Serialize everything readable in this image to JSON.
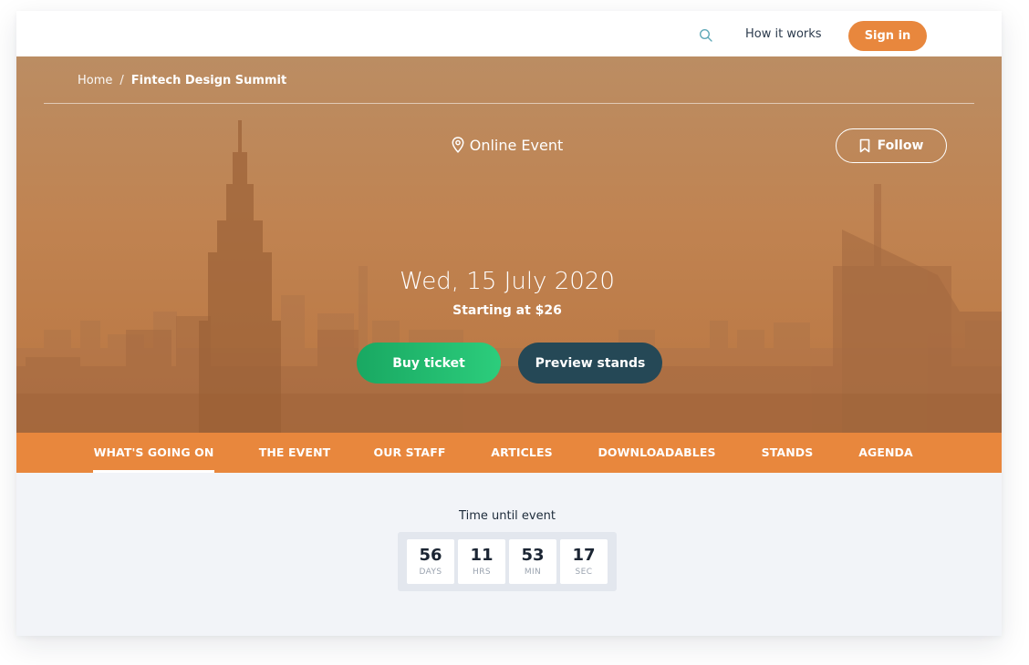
{
  "topbar": {
    "search_icon": "search-icon",
    "how_it_works": "How it works",
    "sign_in": "Sign in"
  },
  "breadcrumb": {
    "home": "Home",
    "separator": "/",
    "current": "Fintech Design Summit"
  },
  "hero": {
    "location_icon": "map-pin-icon",
    "location": "Online Event",
    "follow_icon": "bookmark-icon",
    "follow": "Follow",
    "date": "Wed, 15 July 2020",
    "price": "Starting at $26",
    "buy_ticket": "Buy ticket",
    "preview_stands": "Preview stands"
  },
  "nav": {
    "tabs": [
      {
        "label": "WHAT'S GOING ON",
        "active": true
      },
      {
        "label": "THE EVENT",
        "active": false
      },
      {
        "label": "OUR STAFF",
        "active": false
      },
      {
        "label": "ARTICLES",
        "active": false
      },
      {
        "label": "DOWNLOADABLES",
        "active": false
      },
      {
        "label": "STANDS",
        "active": false
      },
      {
        "label": "AGENDA",
        "active": false
      }
    ]
  },
  "countdown": {
    "label": "Time until event",
    "units": [
      {
        "value": "56",
        "unit": "DAYS"
      },
      {
        "value": "11",
        "unit": "HRS"
      },
      {
        "value": "53",
        "unit": "MIN"
      },
      {
        "value": "17",
        "unit": "SEC"
      }
    ]
  },
  "colors": {
    "accent_orange": "#e8873d",
    "buy_green": "#1fb96c",
    "preview_teal": "#254856",
    "page_bg": "#f2f4f8"
  }
}
